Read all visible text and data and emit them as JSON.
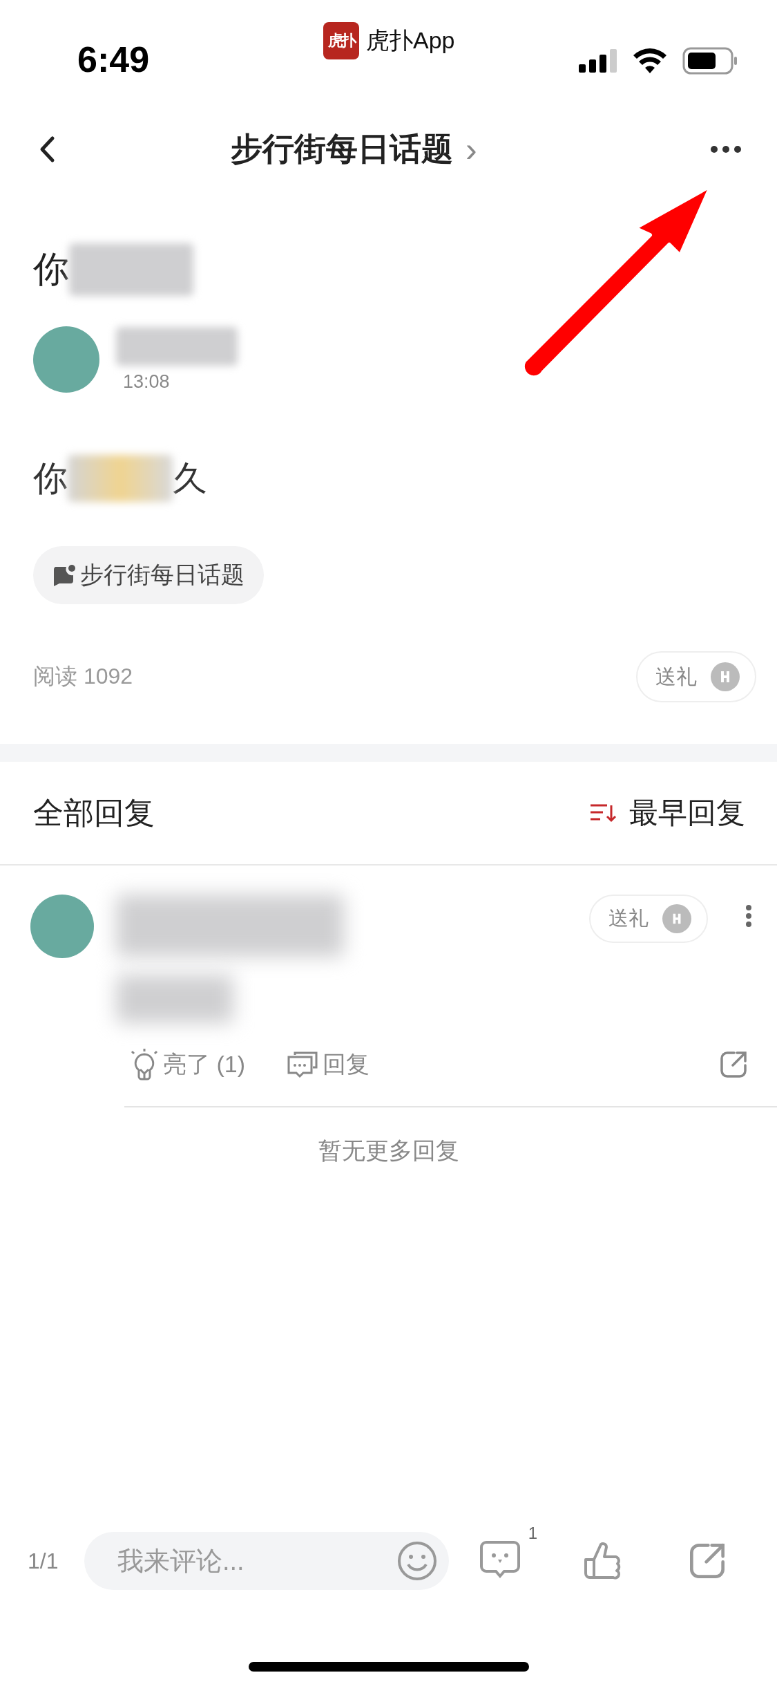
{
  "status_bar": {
    "time": "6:49",
    "app_name": "虎扑App",
    "app_logo_glyph": "虎扑"
  },
  "nav": {
    "title": "步行街每日话题",
    "chevron": "›"
  },
  "post": {
    "title_visible": "你",
    "body_start": "你",
    "body_end": "久",
    "time": "13:08",
    "topic": "步行街每日话题",
    "reads": "阅读 1092",
    "gift": "送礼"
  },
  "replies": {
    "heading": "全部回复",
    "sort": "最早回复",
    "items": [
      {
        "gift": "送礼",
        "light": "亮了 (1)",
        "reply": "回复"
      }
    ],
    "end_note": "暂无更多回复"
  },
  "bottom_bar": {
    "page": "1/1",
    "placeholder": "我来评论...",
    "comment_count": "1"
  }
}
